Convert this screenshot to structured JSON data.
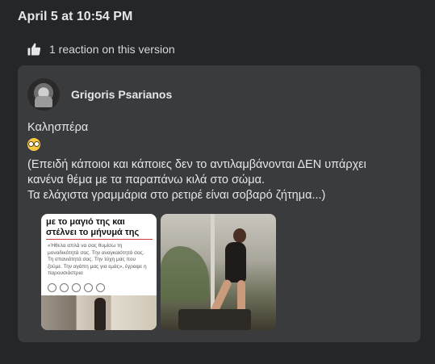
{
  "header": {
    "timestamp": "April 5 at 10:54 PM",
    "reaction_text": "1 reaction on this version"
  },
  "post": {
    "author": "Grigoris Psarianos",
    "greeting": "Καλησπέρα",
    "emoji": "grinning-face-with-glasses",
    "body_lines": [
      "(Επειδή κάποιοι και κάποιες δεν το αντιλαμβάνονται ΔΕΝ υπάρχει",
      "κανένα θέμα με τα παραπάνω κιλά στο σώμα.",
      "Τα ελάχιστα γραμμάρια στο ρετιρέ είναι σοβαρό ζήτημα...)"
    ],
    "images": [
      {
        "headline": "με το μαγιό της και στέλνει το μήνυμά της",
        "article_text": "«Ήθελα απλά να σας θυμίσω τη μοναδικότητά σας. Την αναγκαιότητά σας. Τη σπανιότητά σας. Την τύχη μας που ζούμε. Την αγάπη μας για εμάς», έγραψε η παρουσιάστρια"
      },
      {
        "description_icon": "photo-icon"
      }
    ]
  },
  "icons": {
    "thumb": "thumbs-up-icon"
  }
}
